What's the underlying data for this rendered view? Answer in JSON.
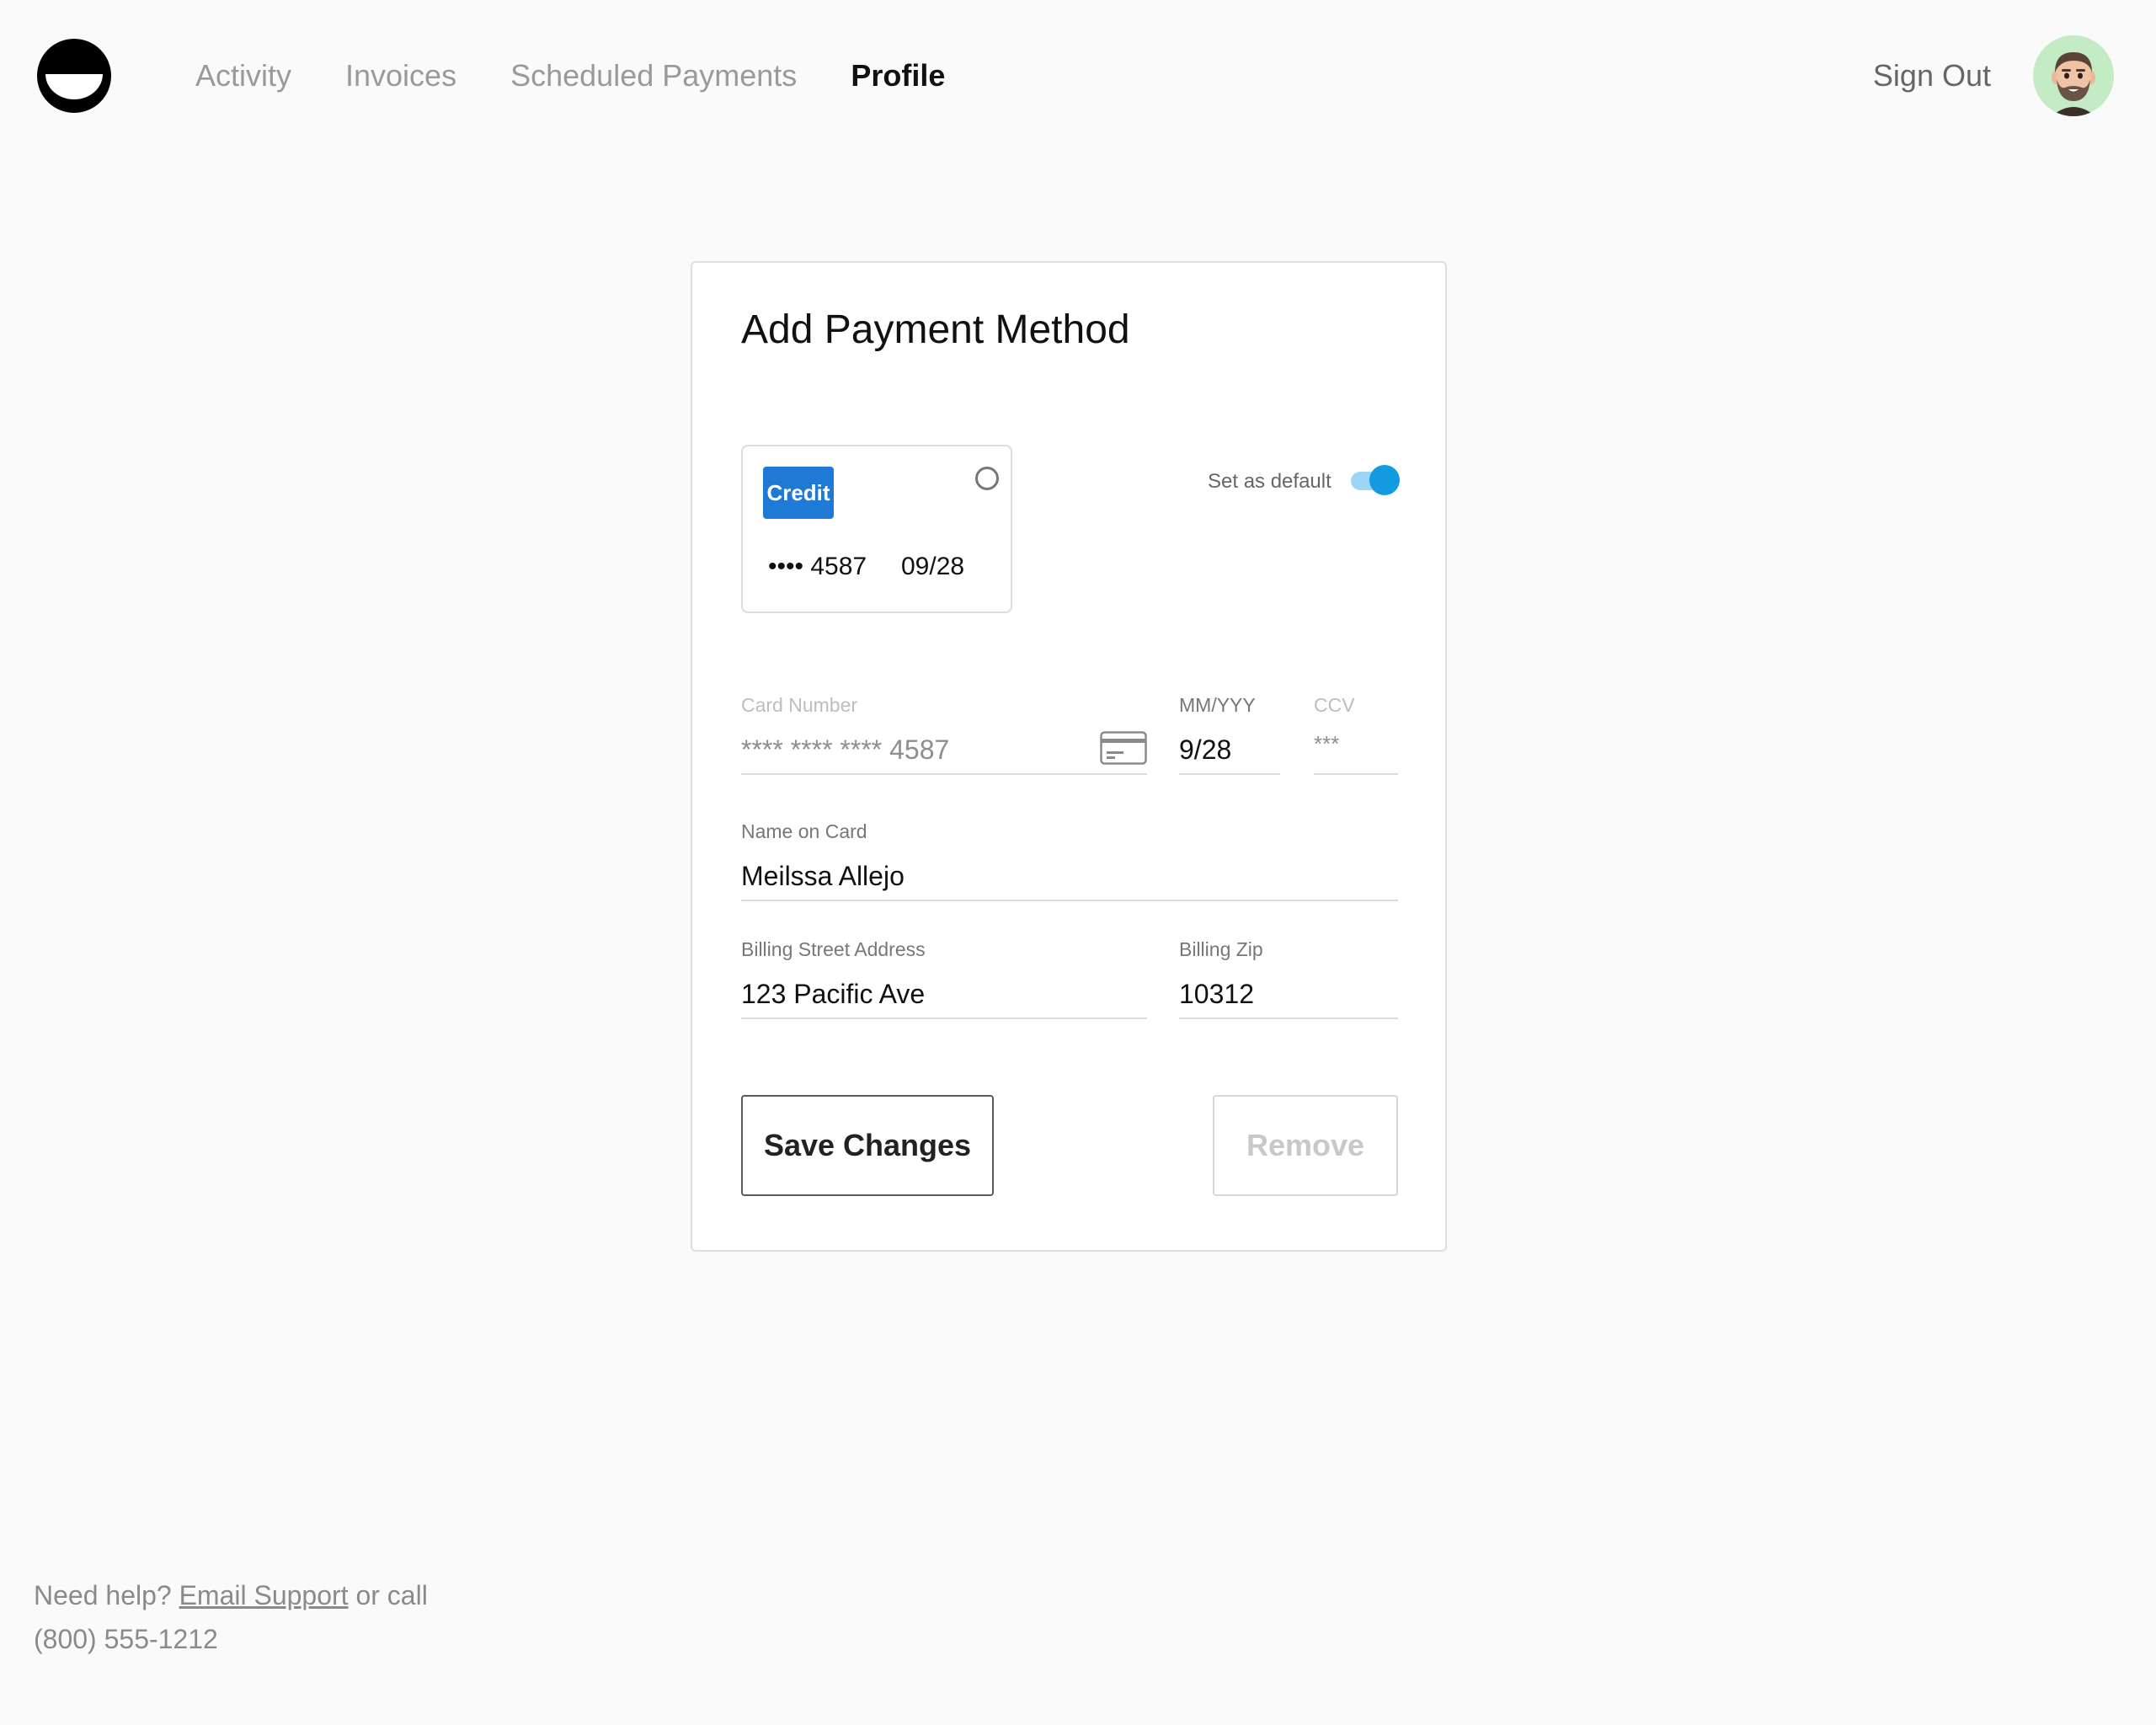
{
  "header": {
    "nav": [
      "Activity",
      "Invoices",
      "Scheduled Payments",
      "Profile"
    ],
    "active_nav": "Profile",
    "sign_out": "Sign Out"
  },
  "panel": {
    "title": "Add Payment Method",
    "card_tile": {
      "badge": "Credit",
      "digits": "•••• 4587",
      "expiry": "09/28",
      "selected": false
    },
    "default_toggle": {
      "label": "Set as default",
      "on": true
    },
    "fields": {
      "card_number": {
        "label": "Card Number",
        "value": "**** **** **** 4587"
      },
      "expiry": {
        "label": "MM/YYY",
        "value": "9/28"
      },
      "ccv": {
        "label": "CCV",
        "value": "***"
      },
      "name": {
        "label": "Name on Card",
        "value": "Meilssa Allejo"
      },
      "street": {
        "label": "Billing Street Address",
        "value": "123 Pacific Ave"
      },
      "zip": {
        "label": "Billing Zip",
        "value": "10312"
      }
    },
    "buttons": {
      "save": "Save Changes",
      "remove": "Remove"
    }
  },
  "footer": {
    "prefix": "Need help? ",
    "link": "Email Support",
    "suffix": " or call",
    "phone": "(800) 555-1212"
  },
  "colors": {
    "background": "#fafafa",
    "badge_blue": "#1f7ad6",
    "toggle_knob": "#139be0",
    "toggle_track": "#9dd6f5",
    "avatar_bg": "#c4ecc4"
  },
  "icons": {
    "logo": "smiley-logo-icon",
    "card": "credit-card-icon",
    "avatar": "memoji-avatar"
  }
}
